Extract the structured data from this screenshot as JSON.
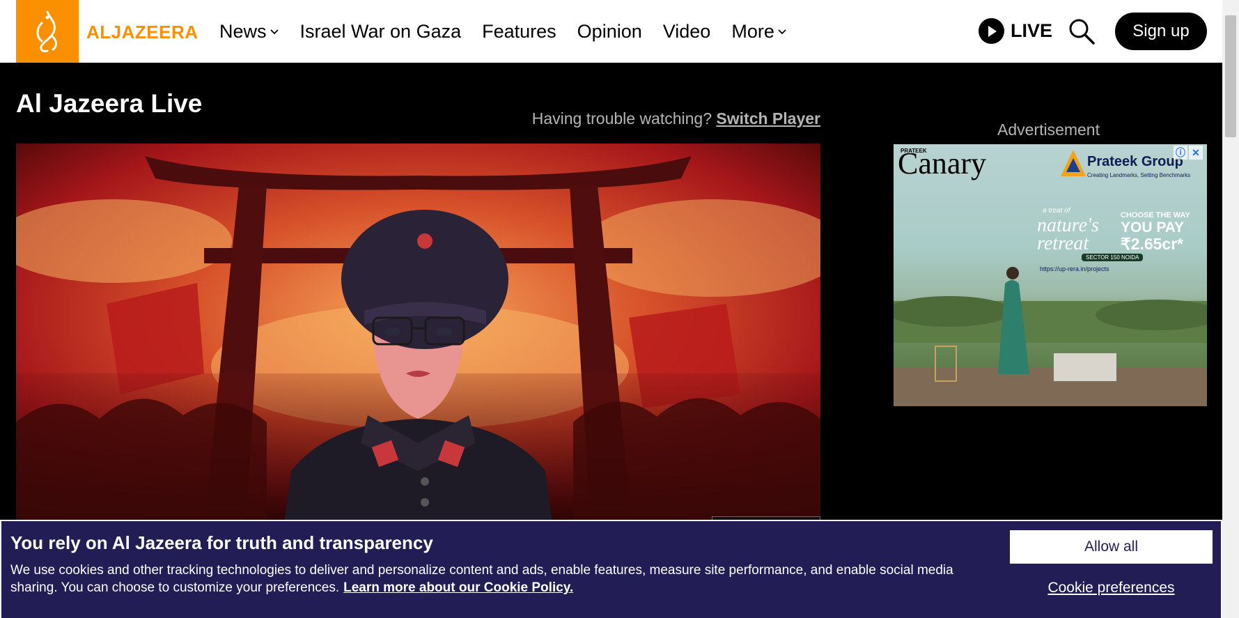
{
  "header": {
    "logo_text": "ALJAZEERA",
    "nav": [
      {
        "label": "News",
        "dropdown": true
      },
      {
        "label": "Israel War on Gaza",
        "dropdown": false
      },
      {
        "label": "Features",
        "dropdown": false
      },
      {
        "label": "Opinion",
        "dropdown": false
      },
      {
        "label": "Video",
        "dropdown": false
      },
      {
        "label": "More",
        "dropdown": true
      }
    ],
    "live_label": "LIVE",
    "signup_label": "Sign up",
    "brand_color": "#fa9000"
  },
  "main": {
    "title": "Al Jazeera Live",
    "trouble_text": "Having trouble watching?",
    "switch_player_label": "Switch Player"
  },
  "advertisement": {
    "label": "Advertisement",
    "brand_small": "PRATEEK",
    "brand": "Canary",
    "group": "Prateek Group",
    "group_tagline": "Creating Landmarks, Setting Benchmarks",
    "headline": "nature's retreat",
    "headline_prefix": "a treat of",
    "pay_line1": "CHOOSE THE WAY",
    "pay_line2": "YOU PAY",
    "price": "₹2.65cr*",
    "sector": "SECTOR 150 NOIDA",
    "url": "https://up-rera.in/projects"
  },
  "cookie": {
    "title": "You rely on Al Jazeera for truth and transparency",
    "text": "We use cookies and other tracking technologies to deliver and personalize content and ads, enable features, measure site performance, and enable social media sharing. You can choose to customize your preferences.",
    "policy_link": "Learn more about our Cookie Policy.",
    "allow_all": "Allow all",
    "preferences": "Cookie preferences",
    "background_color": "#221d54"
  }
}
